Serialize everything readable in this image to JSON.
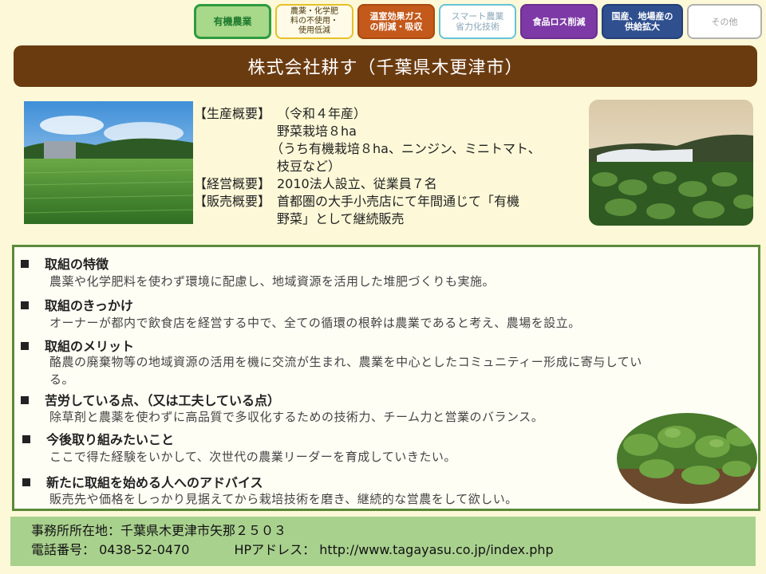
{
  "tags": [
    {
      "label": "有機農業",
      "color": "#1e7a2e",
      "bg": "#a8d88a",
      "border": "#2e9b3e"
    },
    {
      "label": "農薬・化学肥\n料の不使用・\n使用低減",
      "color": "#4a3a10",
      "bg": "#fffbe8",
      "border": "#e6c02a"
    },
    {
      "label": "温室効果ガス\nの削減・吸収",
      "color": "#ffffff",
      "bg": "#c3591a",
      "border": "#a84a12"
    },
    {
      "label": "スマート農業\n省力化技術",
      "color": "#8aa6b8",
      "bg": "#ffffff",
      "border": "#66c3d6"
    },
    {
      "label": "食品ロス削減",
      "color": "#ffffff",
      "bg": "#7d3aa6",
      "border": "#6a2f8f"
    },
    {
      "label": "国産、地場産の\n供給拡大",
      "color": "#ffffff",
      "bg": "#2f4f8f",
      "border": "#243f75"
    },
    {
      "label": "その他",
      "color": "#a0a0a0",
      "bg": "#ffffff",
      "border": "#b0b0b0"
    }
  ],
  "title": "株式会社耕す（千葉県木更津市）",
  "summary": {
    "production_label": "【生産概要】",
    "production_lines": [
      "（令和４年産）",
      "野菜栽培８ha",
      "（うち有機栽培８ha、ニンジン、ミニトマト、",
      "枝豆など）"
    ],
    "management_label": "【経営概要】",
    "management": "2010法人設立、従業員７名",
    "sales_label": "【販売概要】",
    "sales_lines": [
      "首都圏の大手小売店にて年間通じて「有機",
      "野菜」として継続販売"
    ]
  },
  "sections": [
    {
      "heading": "取組の特徴",
      "lines": [
        "農薬や化学肥料を使わず環境に配慮し、地域資源を活用した堆肥づくりも実施。"
      ]
    },
    {
      "heading": "取組のきっかけ",
      "lines": [
        "オーナーが都内で飲食店を経営する中で、全ての循環の根幹は農業であると考え、農場を設立。"
      ]
    },
    {
      "heading": "取組のメリット",
      "lines": [
        "酪農の廃棄物等の地域資源の活用を機に交流が生まれ、農業を中心としたコミュニティー形成に寄与してい",
        "る。"
      ]
    },
    {
      "heading": "苦労している点、（又は工夫している点）",
      "lines": [
        "除草剤と農薬を使わずに高品質で多収化するための技術力、チーム力と営業のバランス。"
      ]
    },
    {
      "heading": "今後取り組みたいこと",
      "lines": [
        "ここで得た経験をいかして、次世代の農業リーダーを育成していきたい。"
      ]
    },
    {
      "heading": "新たに取組を始める人へのアドバイス",
      "lines": [
        "販売先や価格をしっかり見据えてから栽培技術を磨き、継続的な営農をして欲しい。"
      ]
    }
  ],
  "footer": {
    "address": "事務所所在地：千葉県木更津市矢那２５０３",
    "phone": "電話番号： 0438-52-0470",
    "hp": "HPアドレス： http://www.tagayasu.co.jp/index.php"
  }
}
